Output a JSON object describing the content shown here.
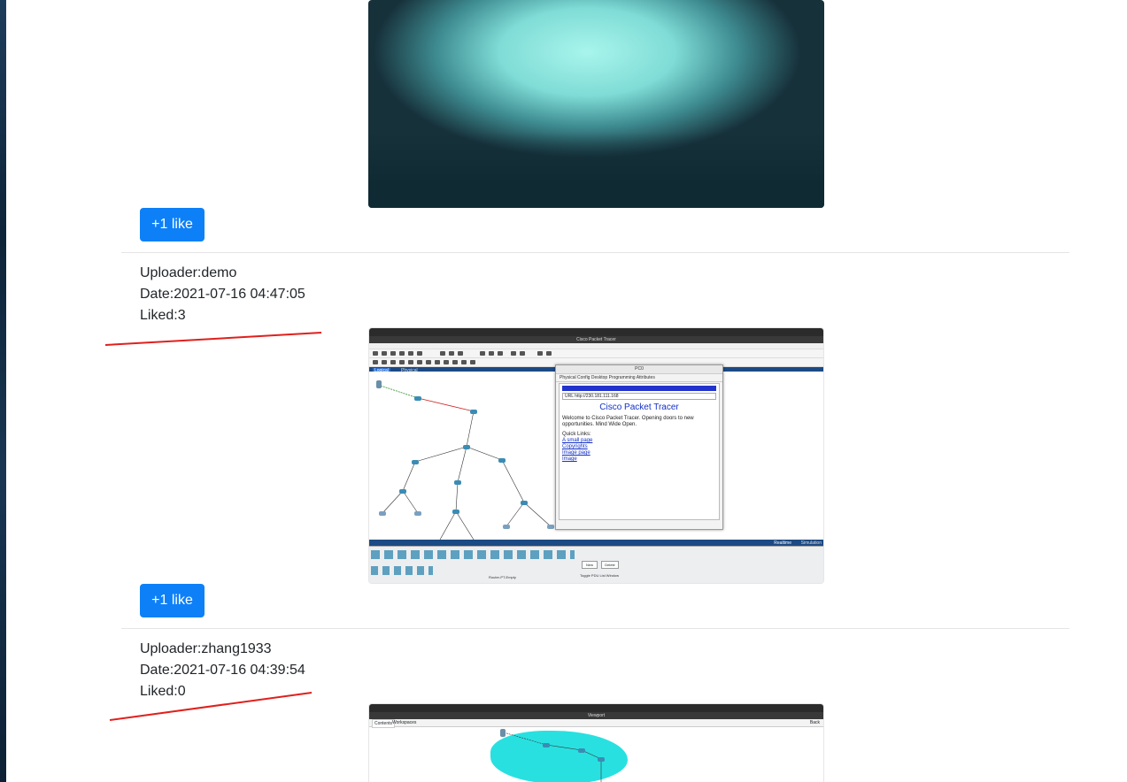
{
  "posts": [
    {
      "like_label": "+1 like"
    },
    {
      "uploader": "Uploader:demo",
      "date": "Date:2021-07-16 04:47:05",
      "liked": "Liked:3",
      "like_label": "+1 like",
      "screenshot": {
        "window_title": "Cisco Packet Tracer",
        "pc_window_title": "PC0",
        "tabs": "Physical  Config  Desktop  Programming  Attributes",
        "url": "URL http://230.181.111.168",
        "site_title": "Cisco Packet Tracer",
        "welcome": "Welcome to Cisco Packet Tracer. Opening doors to new opportunities. Mind Wide Open.",
        "quick_links_heading": "Quick Links:",
        "links": [
          "A small page",
          "Copyrights",
          "Image page",
          "Image"
        ],
        "tab_logical": "Logical",
        "tab_physical": "Physical",
        "mode_realtime": "Realtime",
        "mode_simulation": "Simulation",
        "device_label": "Router-PT-Empty",
        "new_label": "New",
        "delete_label": "Delete",
        "toggle_label": "Toggle PDU List Window"
      }
    },
    {
      "uploader": "Uploader:zhang1933",
      "date": "Date:2021-07-16 04:39:54",
      "liked": "Liked:0",
      "screenshot": {
        "window_title": "Viewport",
        "tab_contents": "Contents",
        "tab_workspaces": "Workspaces",
        "back_label": "Back"
      }
    }
  ],
  "colors": {
    "primary_button": "#0d80f8",
    "annotation_line": "#e0201c",
    "divider": "#e5e5e5"
  }
}
